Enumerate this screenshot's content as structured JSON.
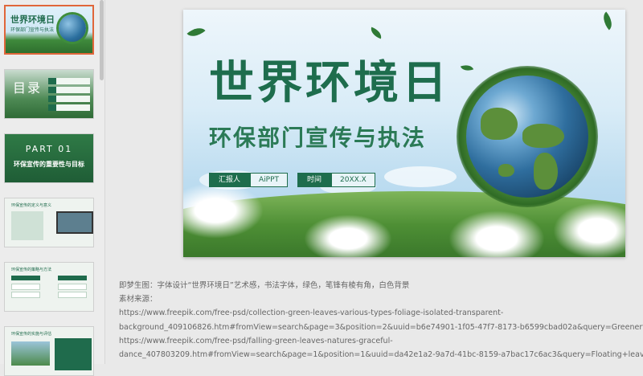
{
  "thumbnails": [
    {
      "title": "世界环境日",
      "subtitle": "环保部门宣传与执法"
    },
    {
      "title": "目录"
    },
    {
      "title": "PART 01",
      "subtitle": "环保宣传的重要性与目标"
    },
    {
      "title": "环保宣传的定义与意义"
    },
    {
      "title": "环保宣传的策略与方法"
    },
    {
      "title": "环保宣传的实施与评估"
    }
  ],
  "slide": {
    "title": "世界环境日",
    "subtitle": "环保部门宣传与执法",
    "reporter_label": "汇报人",
    "reporter_value": "AiPPT",
    "time_label": "时间",
    "time_value": "20XX.X"
  },
  "notes": {
    "line1": "即梦生图：字体设计“世界环境日”艺术感，书法字体，绿色，笔锋有棱有角，白色背景",
    "line2": "素材来源：",
    "line3": "https://www.freepik.com/free-psd/collection-green-leaves-various-types-foliage-isolated-transparent-",
    "line4": "background_409106826.htm#fromView=search&page=3&position=2&uuid=b6e74901-1f05-47f7-8173-b6599cbad02a&query=Greenery",
    "line5": "https://www.freepik.com/free-psd/falling-green-leaves-natures-graceful-",
    "line6": "dance_407803209.htm#fromView=search&page=1&position=1&uuid=da42e1a2-9a7d-41bc-8159-a7bac17c6ac3&query=Floating+leaves"
  }
}
